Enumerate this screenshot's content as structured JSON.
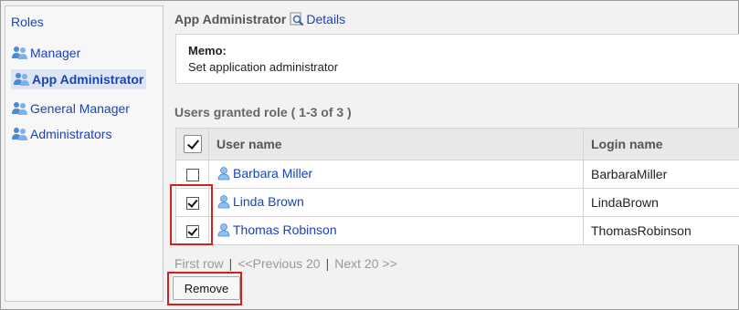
{
  "sidebar": {
    "title": "Roles",
    "items": [
      {
        "label": "Manager"
      },
      {
        "label": "App Administrator"
      },
      {
        "label": "General Manager"
      },
      {
        "label": "Administrators"
      }
    ]
  },
  "header": {
    "title": "App Administrator",
    "details_label": "Details"
  },
  "memo": {
    "label": "Memo:",
    "text": "Set application administrator"
  },
  "granted": {
    "title": "Users granted role ( 1-3 of 3 )",
    "columns": [
      "User name",
      "Login name"
    ],
    "rows": [
      {
        "user_name": "Barbara Miller",
        "login_name": "BarbaraMiller",
        "checked": false
      },
      {
        "user_name": "Linda Brown",
        "login_name": "LindaBrown",
        "checked": true
      },
      {
        "user_name": "Thomas Robinson",
        "login_name": "ThomasRobinson",
        "checked": true
      }
    ]
  },
  "pager": {
    "first": "First row",
    "prev": "<<Previous 20",
    "next": "Next 20 >>",
    "sep": "|"
  },
  "actions": {
    "remove_label": "Remove"
  },
  "colors": {
    "link": "#1a44b3",
    "highlight": "#d32020",
    "selected_bg": "#dbe5f3"
  }
}
